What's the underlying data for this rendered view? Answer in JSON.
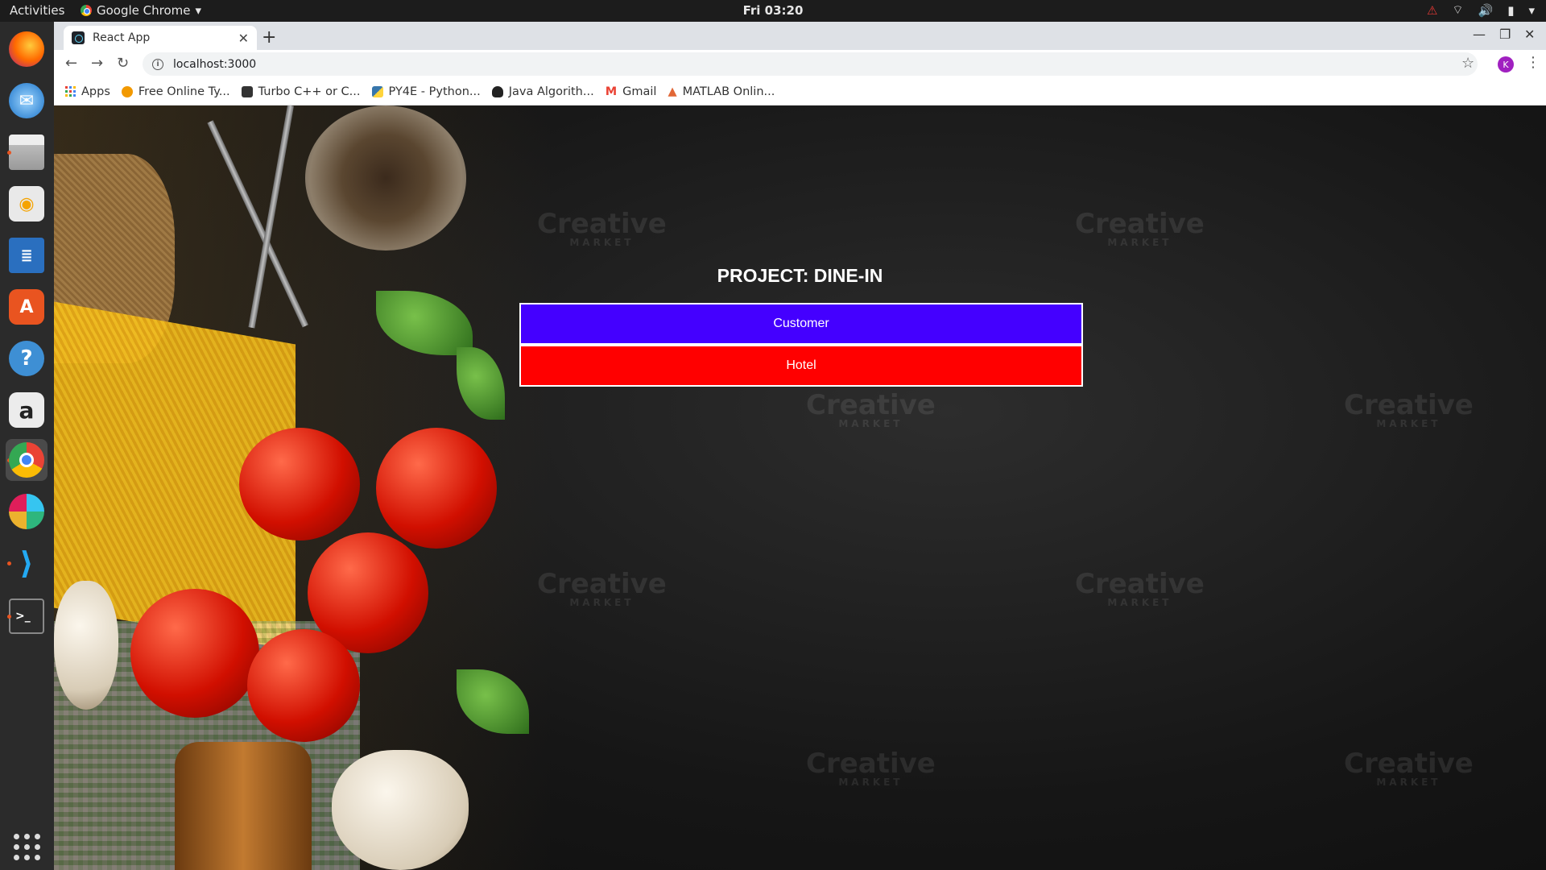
{
  "topbar": {
    "activities": "Activities",
    "app_name": "Google Chrome",
    "clock": "Fri 03:20"
  },
  "browser": {
    "tab_title": "React App",
    "url": "localhost:3000",
    "avatar_letter": "K",
    "bookmarks": [
      {
        "label": "Apps",
        "color": "#4285f4"
      },
      {
        "label": "Free Online Ty...",
        "color": "#f29900"
      },
      {
        "label": "Turbo C++ or C...",
        "color": "#333333"
      },
      {
        "label": "PY4E - Python...",
        "color": "#3776ab"
      },
      {
        "label": "Java Algorith...",
        "color": "#222222"
      },
      {
        "label": "Gmail",
        "color": "#ea4335"
      },
      {
        "label": "MATLAB Onlin...",
        "color": "#e16737"
      }
    ]
  },
  "page": {
    "title": "PROJECT: DINE-IN",
    "customer_label": "Customer",
    "hotel_label": "Hotel",
    "watermark_text": "Creative",
    "watermark_sub": "MARKET",
    "colors": {
      "customer": "#4400ff",
      "hotel": "#ff0000"
    }
  },
  "dock": {
    "items": [
      "firefox-icon",
      "thunderbird-icon",
      "files-icon",
      "rhythmbox-icon",
      "libreoffice-writer-icon",
      "software-center-icon",
      "help-icon",
      "amazon-icon",
      "chrome-icon",
      "slack-icon",
      "vscode-icon",
      "terminal-icon"
    ],
    "show_apps": "show-applications-icon"
  }
}
